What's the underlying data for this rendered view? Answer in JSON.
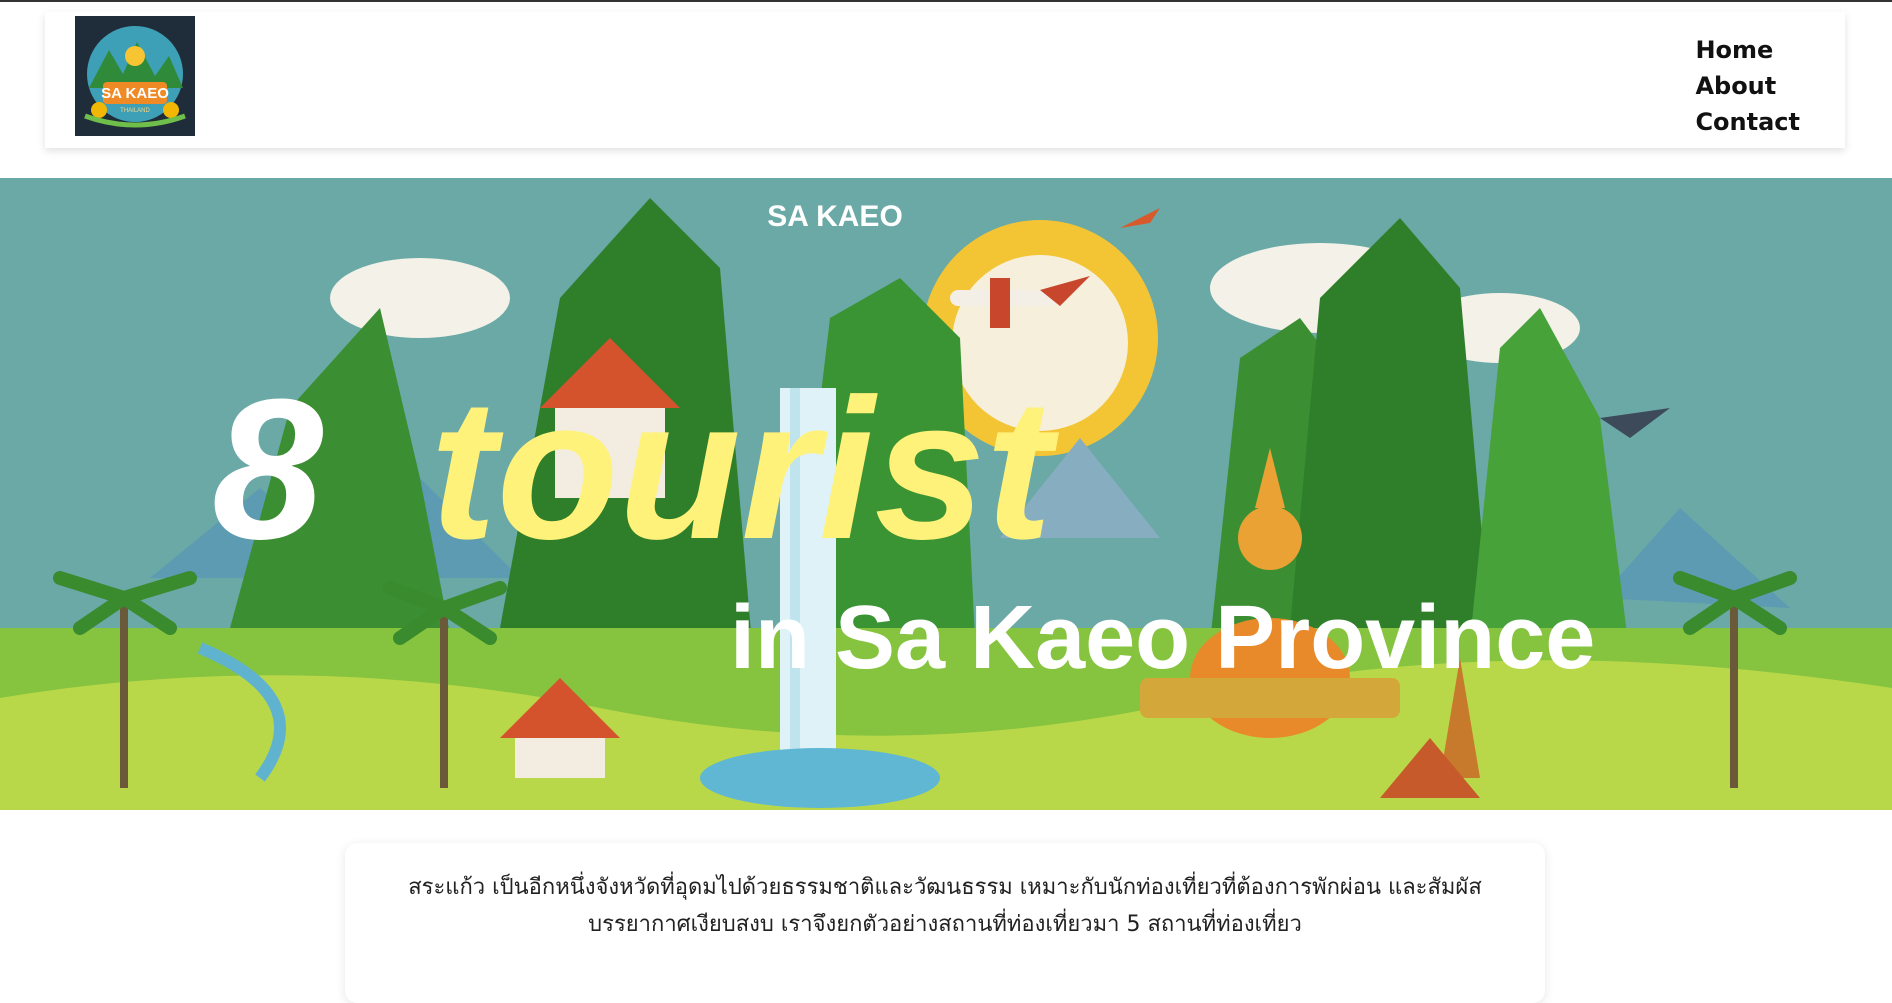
{
  "nav": {
    "logo": {
      "icon": "sa-kaeo-logo-icon",
      "text": "SA KAEO",
      "subtext": "THAILAND"
    },
    "links": [
      "Home",
      "About",
      "Contact"
    ]
  },
  "hero": {
    "province_label": "SA KAEO",
    "headline_number": "8",
    "headline_word": "tourist",
    "subheadline": "in Sa Kaeo Province",
    "colors": {
      "sky": "#6aa9a6",
      "headline_number": "#ffffff",
      "headline_word": "#fff27a",
      "sun": "#f3c534"
    }
  },
  "intro": {
    "text_line1": "สระแก้ว เป็นอีกหนึ่งจังหวัดที่อุดมไปด้วยธรรมชาติและวัฒนธรรม เหมาะกับนักท่องเที่ยวที่ต้องการพักผ่อน และสัมผัส",
    "text_line2": "บรรยากาศเงียบสงบ เราจึงยกตัวอย่างสถานที่ท่องเที่ยวมา 5 สถานที่ท่องเที่ยว"
  }
}
